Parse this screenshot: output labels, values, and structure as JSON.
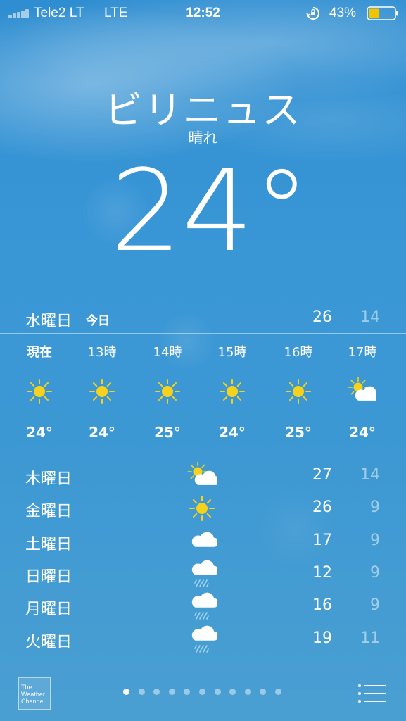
{
  "status_bar": {
    "carrier": "Tele2 LT",
    "network": "LTE",
    "time": "12:52",
    "battery": "43%",
    "signal_bars": 5,
    "battery_level": 0.43,
    "battery_color": "#f2c400"
  },
  "location": {
    "city": "ビリニュス",
    "condition": "晴れ",
    "temperature": "24°"
  },
  "today": {
    "day": "水曜日",
    "label": "今日",
    "high": "26",
    "low": "14"
  },
  "hourly": [
    {
      "time": "現在",
      "icon": "sun-icon",
      "temp": "24°"
    },
    {
      "time": "13時",
      "icon": "sun-icon",
      "temp": "24°"
    },
    {
      "time": "14時",
      "icon": "sun-icon",
      "temp": "25°"
    },
    {
      "time": "15時",
      "icon": "sun-icon",
      "temp": "24°"
    },
    {
      "time": "16時",
      "icon": "sun-icon",
      "temp": "25°"
    },
    {
      "time": "17時",
      "icon": "partly-cloudy-icon",
      "temp": "24°"
    }
  ],
  "daily": [
    {
      "day": "木曜日",
      "icon": "partly-cloudy-icon",
      "high": "27",
      "low": "14"
    },
    {
      "day": "金曜日",
      "icon": "sun-icon",
      "high": "26",
      "low": "9"
    },
    {
      "day": "土曜日",
      "icon": "cloud-icon",
      "high": "17",
      "low": "9"
    },
    {
      "day": "日曜日",
      "icon": "rain-icon",
      "high": "12",
      "low": "9"
    },
    {
      "day": "月曜日",
      "icon": "rain-icon",
      "high": "16",
      "low": "9"
    },
    {
      "day": "火曜日",
      "icon": "rain-icon",
      "high": "19",
      "low": "11"
    }
  ],
  "footer": {
    "logo_text": "The Weather Channel",
    "page_count": 11,
    "active_page": 0
  },
  "colors": {
    "sun": "#f7d21b",
    "cloud": "#ffffff",
    "rain": "#9fd4f2"
  }
}
